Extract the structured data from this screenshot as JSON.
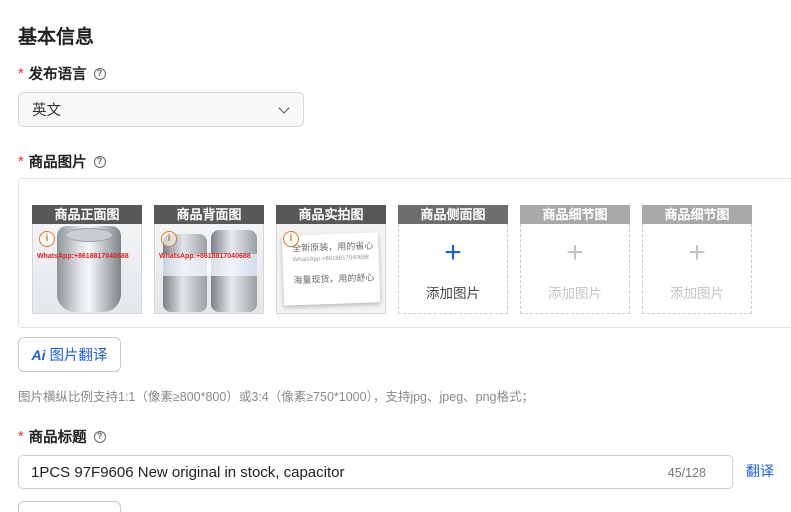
{
  "section_title": "基本信息",
  "language": {
    "label": "发布语言",
    "value": "英文"
  },
  "images": {
    "label": "商品图片",
    "slots": [
      {
        "header": "商品正面图",
        "state": "filled",
        "watermark": "WhatsApp:+8618817040688",
        "add_text": ""
      },
      {
        "header": "商品背面图",
        "state": "filled",
        "watermark": "WhatsApp:+8618817040688",
        "add_text": ""
      },
      {
        "header": "商品实拍图",
        "state": "filled",
        "watermark": "WhatsApp:+8618817040688",
        "add_text": ""
      },
      {
        "header": "商品侧面图",
        "state": "empty",
        "add_text": "添加图片"
      },
      {
        "header": "商品细节图",
        "state": "faded",
        "add_text": "添加图片"
      },
      {
        "header": "商品细节图",
        "state": "faded",
        "add_text": "添加图片"
      }
    ],
    "paper_lines": [
      "全新原装，用的省心",
      "WhatsApp:+8618817040688",
      "海量现货，用的舒心"
    ],
    "translate_button": "图片翻译",
    "ai_icon": "Ai",
    "hint": "图片横纵比例支持1:1（像素≥800*800）或3:4（像素≥750*1000），支持jpg、jpeg、png格式；"
  },
  "product_title": {
    "label": "商品标题",
    "value": "1PCS 97F9606 New original in stock, capacitor",
    "char_count": "45/128",
    "translate_link": "翻译"
  },
  "icons": {
    "help": "help-circle-icon",
    "dropdown": "chevron-down-icon",
    "info": "info-icon",
    "add": "plus-icon",
    "ai": "ai-translate-icon"
  },
  "colors": {
    "required": "#e5322d",
    "accent": "#1f5fd6",
    "slot_header": "#585858",
    "info_warning": "#e07a1f"
  }
}
